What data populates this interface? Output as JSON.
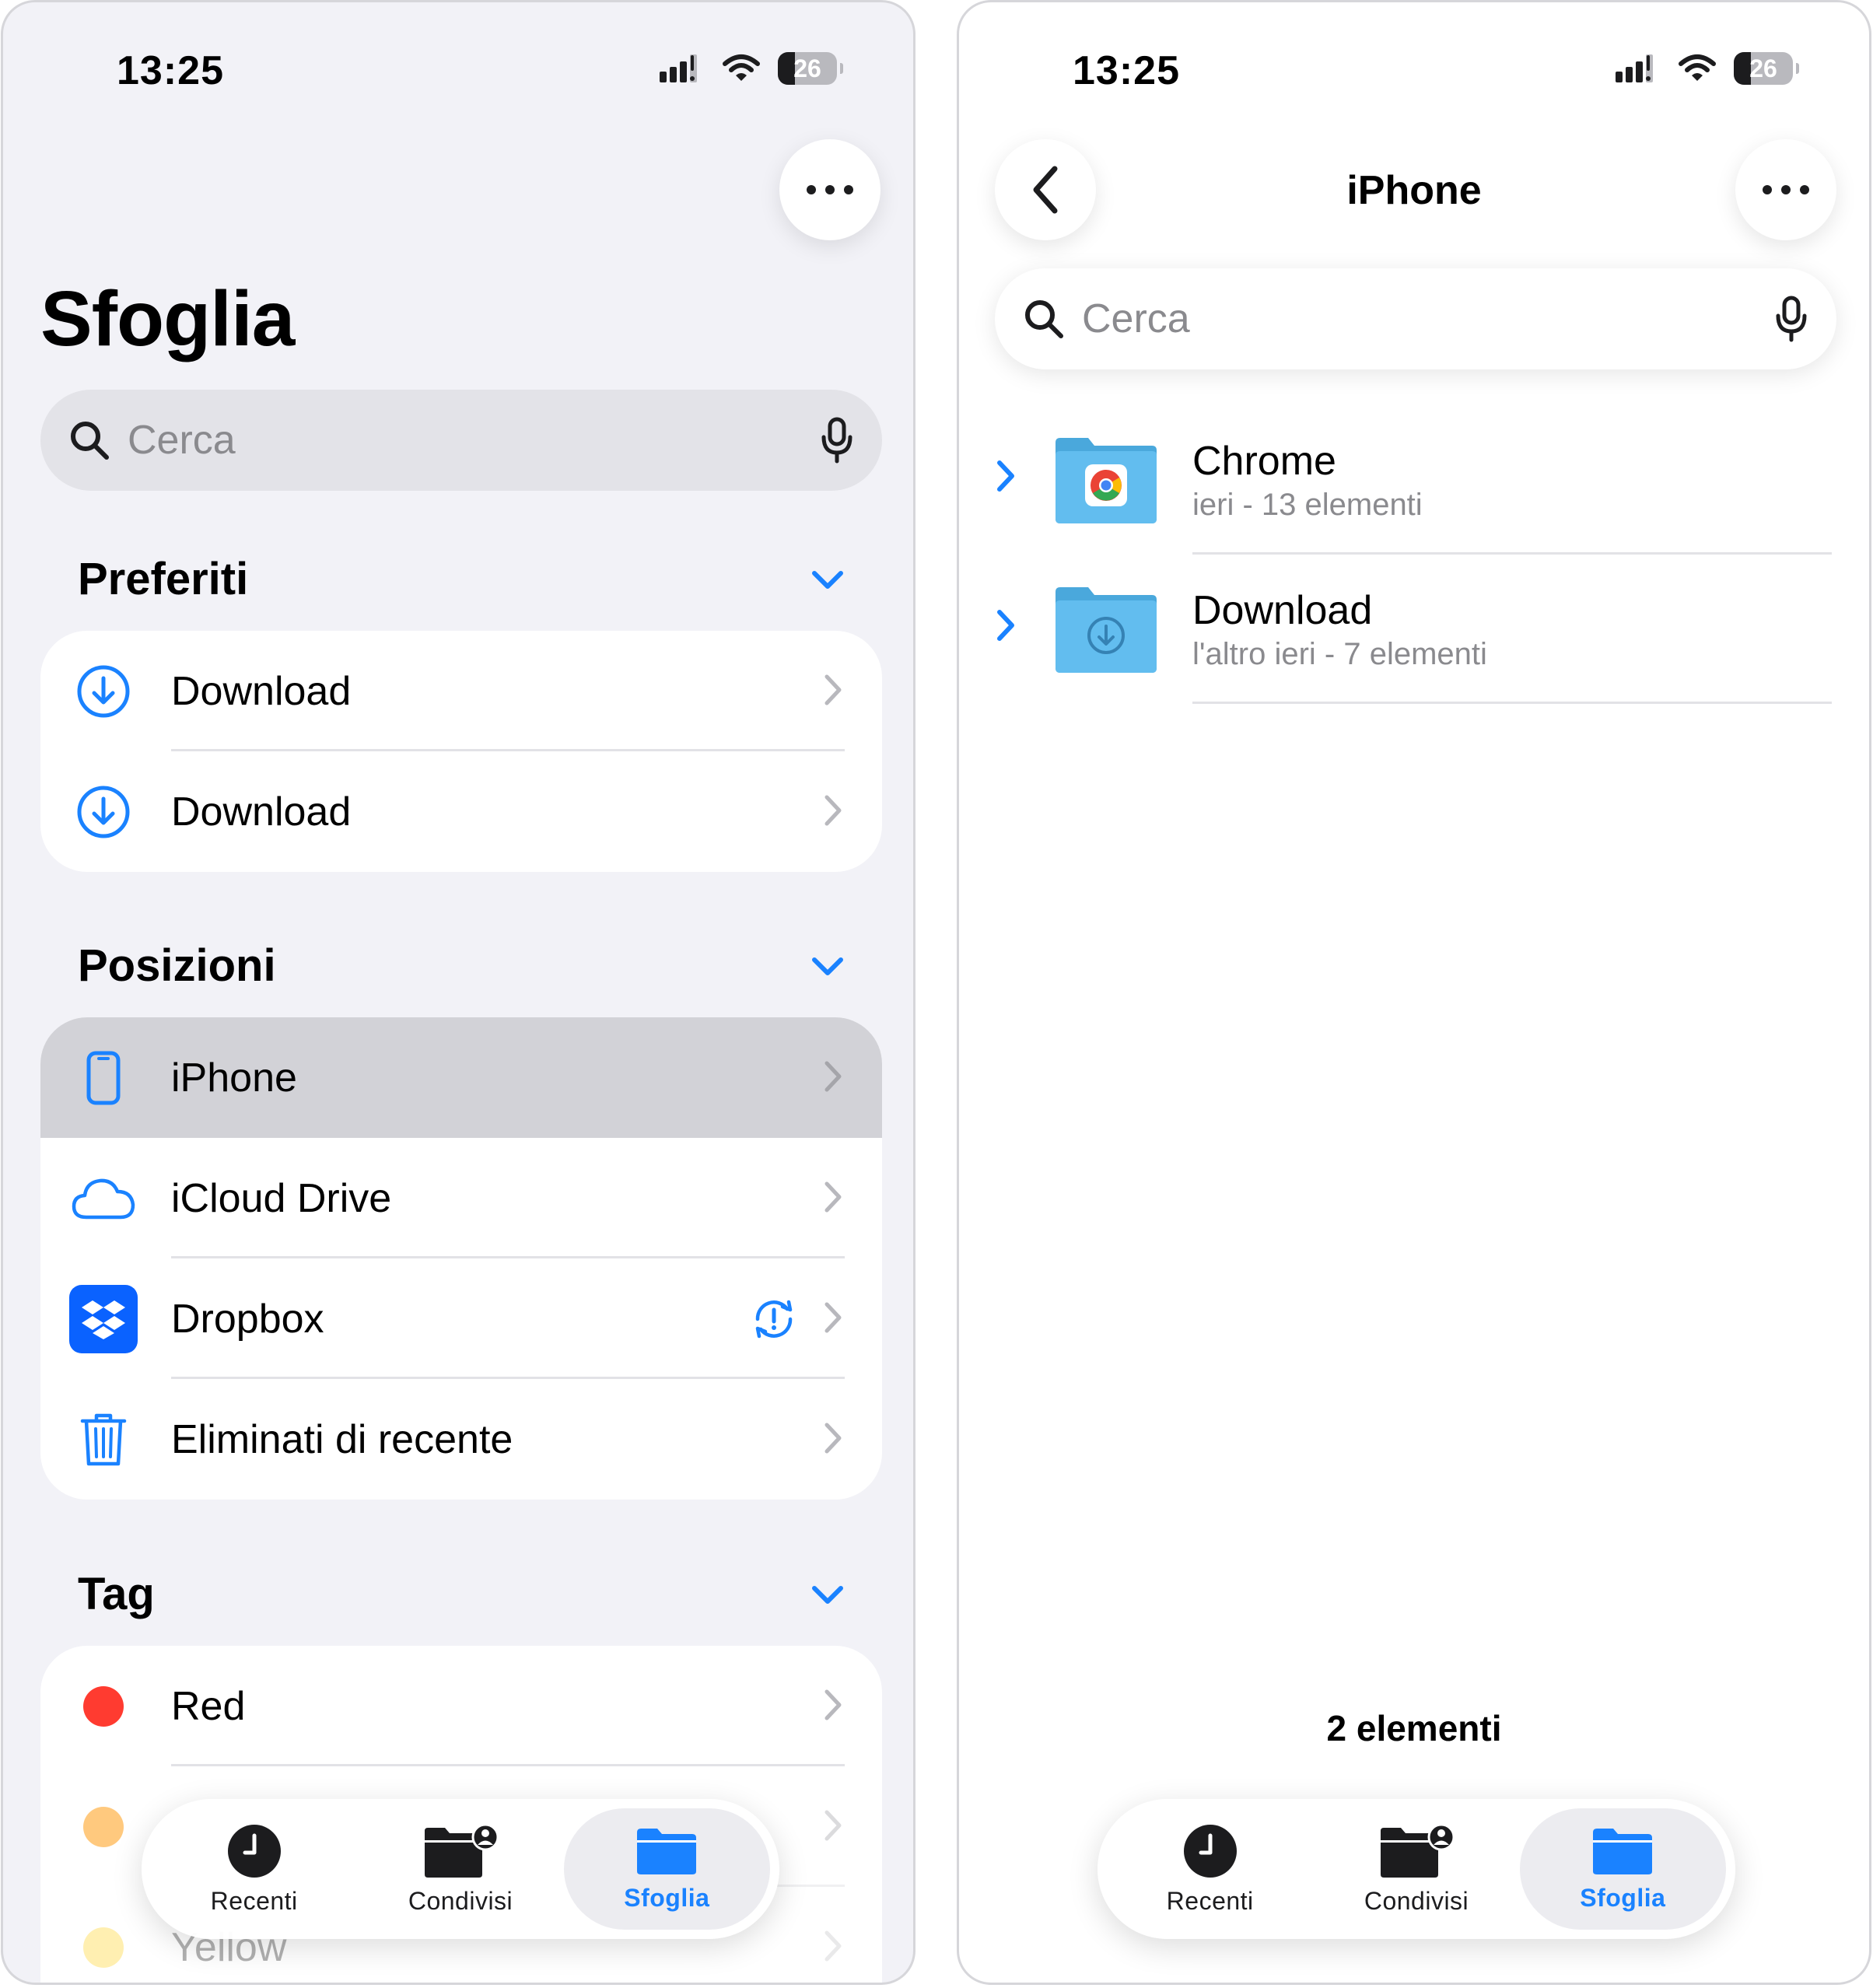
{
  "left": {
    "status": {
      "time": "13:25",
      "battery": "26"
    },
    "title": "Sfoglia",
    "search": {
      "placeholder": "Cerca"
    },
    "sections": {
      "favorites": {
        "title": "Preferiti",
        "items": [
          {
            "label": "Download"
          },
          {
            "label": "Download"
          }
        ]
      },
      "locations": {
        "title": "Posizioni",
        "items": [
          {
            "label": "iPhone"
          },
          {
            "label": "iCloud Drive"
          },
          {
            "label": "Dropbox"
          },
          {
            "label": "Eliminati di recente"
          }
        ]
      },
      "tags": {
        "title": "Tag",
        "items": [
          {
            "label": "Red",
            "color": "#ff3b30"
          },
          {
            "label": "",
            "color": "#ff9500"
          },
          {
            "label": "Yellow",
            "color": "#ffcc00"
          }
        ]
      }
    },
    "tabbar": {
      "tabs": [
        {
          "label": "Recenti"
        },
        {
          "label": "Condivisi"
        },
        {
          "label": "Sfoglia"
        }
      ],
      "active": "Sfoglia"
    }
  },
  "right": {
    "status": {
      "time": "13:25",
      "battery": "26"
    },
    "nav": {
      "title": "iPhone"
    },
    "search": {
      "placeholder": "Cerca"
    },
    "folders": [
      {
        "name": "Chrome",
        "meta": "ieri - 13 elementi"
      },
      {
        "name": "Download",
        "meta": "l'altro ieri - 7 elementi"
      }
    ],
    "item_count": "2 elementi",
    "tabbar": {
      "tabs": [
        {
          "label": "Recenti"
        },
        {
          "label": "Condivisi"
        },
        {
          "label": "Sfoglia"
        }
      ],
      "active": "Sfoglia"
    }
  },
  "colors": {
    "accent": "#1a82ff",
    "background": "#f2f2f7",
    "selected_row": "#d2d2d7"
  }
}
